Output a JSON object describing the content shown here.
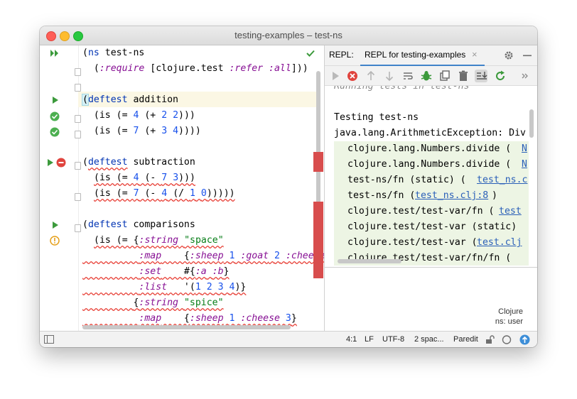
{
  "window": {
    "title": "testing-examples – test-ns"
  },
  "editor": {
    "lines": {
      "l1": {
        "a": "(",
        "b": "ns",
        "c": " test-ns"
      },
      "l2": {
        "a": "  (",
        "b": ":require",
        "c": " [clojure.test ",
        "d": ":refer",
        "e": " ",
        "f": ":all",
        "g": "]))"
      },
      "l4": {
        "a": "(",
        "b": "deftest",
        "c": " addition"
      },
      "l5": {
        "a": "  (is (= ",
        "b": "4",
        "c": " (+ ",
        "d": "2",
        "e": " ",
        "f": "2",
        "g": ")))"
      },
      "l6": {
        "a": "  (is (= ",
        "b": "7",
        "c": " (+ ",
        "d": "3",
        "e": " ",
        "f": "4",
        "g": "))))"
      },
      "l8": {
        "a": "(",
        "b": "deftest",
        "c": " subtraction"
      },
      "l9": {
        "a": "(is (= ",
        "b": "4",
        "c": " (- ",
        "d": "7",
        "e": " ",
        "f": "3",
        "g": ")))"
      },
      "l10": {
        "a": "(is (= ",
        "b": "7",
        "c": " (- ",
        "d": "4",
        "e": " (/ ",
        "f": "1",
        "g": " ",
        "h": "0",
        "i": ")))))"
      },
      "l12": {
        "a": "(",
        "b": "deftest",
        "c": " comparisons"
      },
      "l13": {
        "a": "(is (= {",
        "b": ":string",
        "c": " ",
        "d": "\"space\""
      },
      "l14": {
        "a": ":map",
        "b": "    {",
        "c": ":sheep",
        "d": " ",
        "e": "1",
        "f": " ",
        "g": ":goat",
        "h": " ",
        "i": "2",
        "j": " ",
        "k": ":cheese"
      },
      "l15": {
        "a": ":set",
        "b": "    #{",
        "c": ":a",
        "d": " ",
        "e": ":b",
        "f": "}"
      },
      "l16": {
        "a": ":list",
        "b": "   '(",
        "c": "1",
        "d": " ",
        "e": "2",
        "f": " ",
        "g": "3",
        "h": " ",
        "i": "4",
        "j": ")}"
      },
      "l17": {
        "a": "{",
        "b": ":string",
        "c": " ",
        "d": "\"spice\""
      },
      "l18": {
        "a": ":map",
        "b": "    {",
        "c": ":sheep",
        "d": " ",
        "e": "1",
        "f": " ",
        "g": ":cheese",
        "h": " ",
        "i": "3",
        "j": "}"
      }
    }
  },
  "repl": {
    "label": "REPL:",
    "tab_label": "REPL for testing-examples",
    "close_glyph": "×",
    "console": {
      "partial": "Running tests in test-ns",
      "testing": "Testing test-ns",
      "exception": "java.lang.ArithmeticException: Div",
      "stack": [
        {
          "text": "clojure.lang.Numbers.divide (",
          "link": "N"
        },
        {
          "text": "clojure.lang.Numbers.divide (",
          "link": "N"
        },
        {
          "text": "test-ns/fn (static) (",
          "link": "test_ns.c"
        },
        {
          "text": "test-ns/fn (",
          "link": "test_ns.clj:8",
          "tail": ")"
        },
        {
          "text": "clojure.test/test-var/fn (",
          "link": "test"
        },
        {
          "text": "clojure.test/test-var (static)",
          "link": ""
        },
        {
          "text": "clojure.test/test-var (",
          "link": "test.clj"
        },
        {
          "text": "clojure.test/test-var/fn/fn (",
          "link": ""
        }
      ]
    },
    "input_info": {
      "language": "Clojure",
      "namespace": "ns: user"
    }
  },
  "statusbar": {
    "position": "4:1",
    "line_ending": "LF",
    "encoding": "UTF-8",
    "indent": "2 spac...",
    "mode": "Paredit"
  },
  "colors": {
    "run_green": "#3c9a3c",
    "pass_green": "#4caf50",
    "error_red": "#e0443e",
    "warn_orange": "#e5a01b",
    "error_stripe": "#d84d4d",
    "link_blue": "#2a5fb8"
  }
}
